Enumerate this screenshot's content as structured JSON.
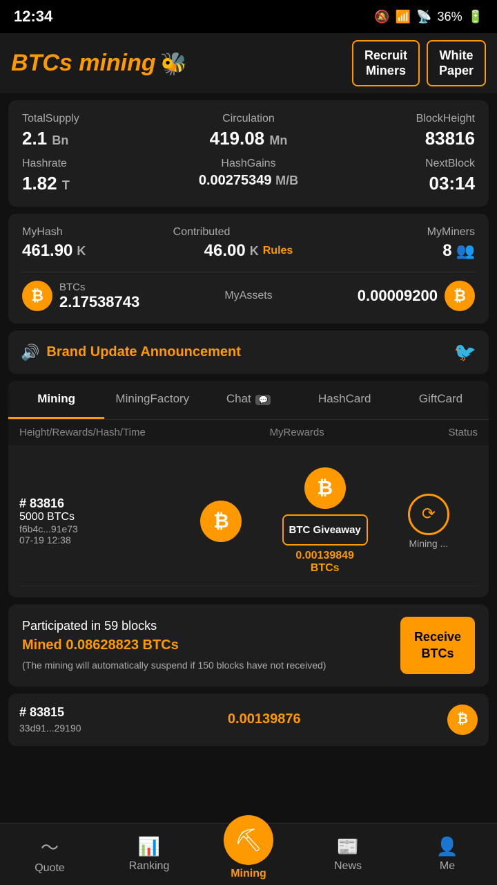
{
  "statusBar": {
    "time": "12:34",
    "battery": "36%"
  },
  "header": {
    "logo": "BTCs mining",
    "logoEmoji": "🐝",
    "buttons": {
      "recruit": "Recruit\nMiners",
      "whitePaper": "White\nPaper"
    }
  },
  "stats": {
    "totalSupply": {
      "label": "TotalSupply",
      "value": "2.1",
      "unit": "Bn"
    },
    "circulation": {
      "label": "Circulation",
      "value": "419.08",
      "unit": "Mn"
    },
    "blockHeight": {
      "label": "BlockHeight",
      "value": "83816"
    },
    "hashrate": {
      "label": "Hashrate",
      "value": "1.82",
      "unit": "T"
    },
    "hashGains": {
      "label": "HashGains",
      "value": "0.00275349",
      "unit": "M/B"
    },
    "nextBlock": {
      "label": "NextBlock",
      "value": "03:14"
    }
  },
  "myHash": {
    "myHash": {
      "label": "MyHash",
      "value": "461.90",
      "unit": "K"
    },
    "contributed": {
      "label": "Contributed",
      "value": "46.00",
      "unit": "K",
      "rulesLabel": "Rules"
    },
    "myMiners": {
      "label": "MyMiners",
      "value": "8"
    }
  },
  "assets": {
    "btcsLabel": "BTCs",
    "btcsAmount": "2.17538743",
    "myAssetsLabel": "MyAssets",
    "btcLabel": "BTC",
    "btcAmount": "0.00009200"
  },
  "announcement": {
    "text": "Brand Update Announcement"
  },
  "tabs": [
    {
      "id": "mining",
      "label": "Mining",
      "active": true
    },
    {
      "id": "miningFactory",
      "label": "MiningFactory",
      "active": false
    },
    {
      "id": "chat",
      "label": "Chat",
      "badge": "💬",
      "active": false
    },
    {
      "id": "hashCard",
      "label": "HashCard",
      "active": false
    },
    {
      "id": "giftCard",
      "label": "GiftCard",
      "active": false
    }
  ],
  "tableHeader": {
    "col1": "Height/Rewards/Hash/Time",
    "col2": "MyRewards",
    "col3": "Status"
  },
  "miningEntry": {
    "block": "# 83816",
    "btcs": "5000 BTCs",
    "hash": "f6b4c...91e73",
    "time": "07-19 12:38",
    "myRewardsAmount": "0.00139849",
    "myRewardsUnit": "BTCs",
    "giveawayLabel": "BTC Giveaway",
    "statusLabel": "Mining ..."
  },
  "participated": {
    "blocksText": "Participated in 59 blocks",
    "minedAmount": "Mined 0.08628823 BTCs",
    "note": "(The mining will automatically suspend\nif 150 blocks have not received)",
    "receiveLabel": "Receive\nBTCs"
  },
  "miningEntry2": {
    "block": "# 83815",
    "hash": "33d91...29190",
    "amount": "0.00139876"
  },
  "bottomNav": [
    {
      "id": "quote",
      "label": "Quote",
      "icon": "〜"
    },
    {
      "id": "ranking",
      "label": "Ranking",
      "icon": "📊"
    },
    {
      "id": "mining",
      "label": "Mining",
      "icon": "⛏",
      "center": true
    },
    {
      "id": "news",
      "label": "News",
      "icon": "📰"
    },
    {
      "id": "me",
      "label": "Me",
      "icon": "👤"
    }
  ]
}
